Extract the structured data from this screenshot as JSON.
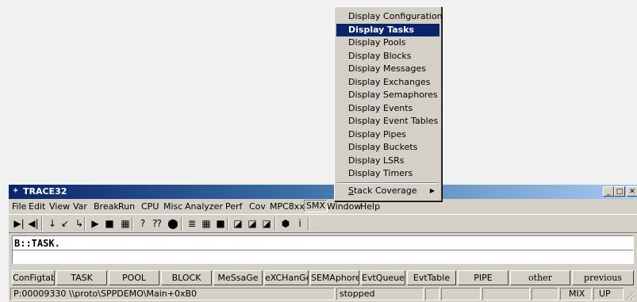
{
  "popup_menu": {
    "items": [
      {
        "label": "Display Configuration"
      },
      {
        "label": "Display Tasks",
        "selected": true
      },
      {
        "label": "Display Pools"
      },
      {
        "label": "Display Blocks"
      },
      {
        "label": "Display Messages"
      },
      {
        "label": "Display Exchanges"
      },
      {
        "label": "Display Semaphores"
      },
      {
        "label": "Display Events"
      },
      {
        "label": "Display Event Tables"
      },
      {
        "label": "Display Pipes"
      },
      {
        "label": "Display Buckets"
      },
      {
        "label": "Display LSRs"
      },
      {
        "label": "Display Timers"
      }
    ],
    "submenu": {
      "label_prefix": "S",
      "label_rest": "tack Coverage",
      "arrow": "▶"
    }
  },
  "window": {
    "title": "TRACE32",
    "title_icon": "trace32-app-icon",
    "controls": {
      "minimize": "_",
      "maximize": "□",
      "close": "✕"
    }
  },
  "menubar": [
    "File",
    "Edit",
    "View",
    "Var",
    "Break",
    "Run",
    "CPU",
    "Misc",
    "Analyzer",
    "Perf",
    "Cov",
    "MPC8xx",
    "SMX",
    "Window",
    "Help"
  ],
  "menubar_active": "SMX",
  "toolbar": {
    "icons": [
      "step-icon",
      "step-back-icon",
      "step-over-icon",
      "step-into-icon",
      "return-icon",
      "go-icon",
      "stop-icon",
      "no-break-icon",
      "help-icon",
      "context-help-icon",
      "stop-sign-icon",
      "list-icon",
      "dump-icon",
      "register-icon",
      "chart-icon",
      "chart2-icon",
      "chart3-icon",
      "cpu-icon",
      "info-icon"
    ],
    "glyphs": [
      "▶|",
      "◀|",
      "↓",
      "↙",
      "↳",
      "▶",
      "■",
      "▦",
      "?",
      "⁇",
      "⬤",
      "≣",
      "▦",
      "■",
      "◪",
      "◪",
      "◪",
      "⬢",
      "i"
    ]
  },
  "command": {
    "value": "B::TASK."
  },
  "softkeys": [
    {
      "label": "ConFigtab"
    },
    {
      "label": "TASK"
    },
    {
      "label": "POOL"
    },
    {
      "label": "BLOCK"
    },
    {
      "label": "MeSsaGe"
    },
    {
      "label": "eXCHanGe"
    },
    {
      "label": "SEMAphore"
    },
    {
      "label": "EvtQueue"
    },
    {
      "label": "EvtTable"
    },
    {
      "label": "PIPE"
    },
    {
      "label": "other"
    },
    {
      "label": "previous"
    }
  ],
  "statusbar": {
    "address": "P:00009330 \\\\proto\\SPPDEMO\\Main+0xB0",
    "state": "stopped",
    "mode": "MIX",
    "direction": "UP"
  },
  "colors": {
    "selection": "#0a246a",
    "face": "#d4d0c8",
    "background": "#f1f1f1"
  }
}
